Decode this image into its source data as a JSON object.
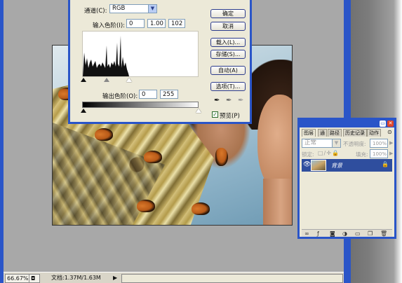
{
  "levels": {
    "channel_label": "通道(C):",
    "channel_value": "RGB",
    "input_label": "输入色阶(I):",
    "input_black": "0",
    "input_gamma": "1.00",
    "input_white": "102",
    "output_label": "输出色阶(O):",
    "output_black": "0",
    "output_white": "255",
    "preview_label": "预览(P)",
    "preview_checked": true,
    "buttons": {
      "ok": "确定",
      "cancel": "取消",
      "load": "载入(L)...",
      "save": "存储(S)...",
      "auto": "自动(A)",
      "options": "选项(T)..."
    },
    "eyedroppers": [
      "black-eyedropper-icon",
      "gray-eyedropper-icon",
      "white-eyedropper-icon"
    ]
  },
  "layers": {
    "tabs": [
      "图层",
      "通",
      "路径",
      "历史记录",
      "动作"
    ],
    "blend_mode": "正常",
    "opacity_label": "不透明度:",
    "opacity_value": "100%",
    "lock_label": "锁定:",
    "fill_label": "填充:",
    "fill_value": "100%",
    "layer_name": "背景",
    "icons": [
      "eye-icon",
      "lock-icon"
    ]
  },
  "status": {
    "zoom": "66.67%",
    "doc_info": "文档:1.37M/1.63M"
  },
  "colors": {
    "xp_blue": "#2a55c8",
    "dialog_bg": "#ece9d8",
    "workspace": "#a8a8a8"
  }
}
